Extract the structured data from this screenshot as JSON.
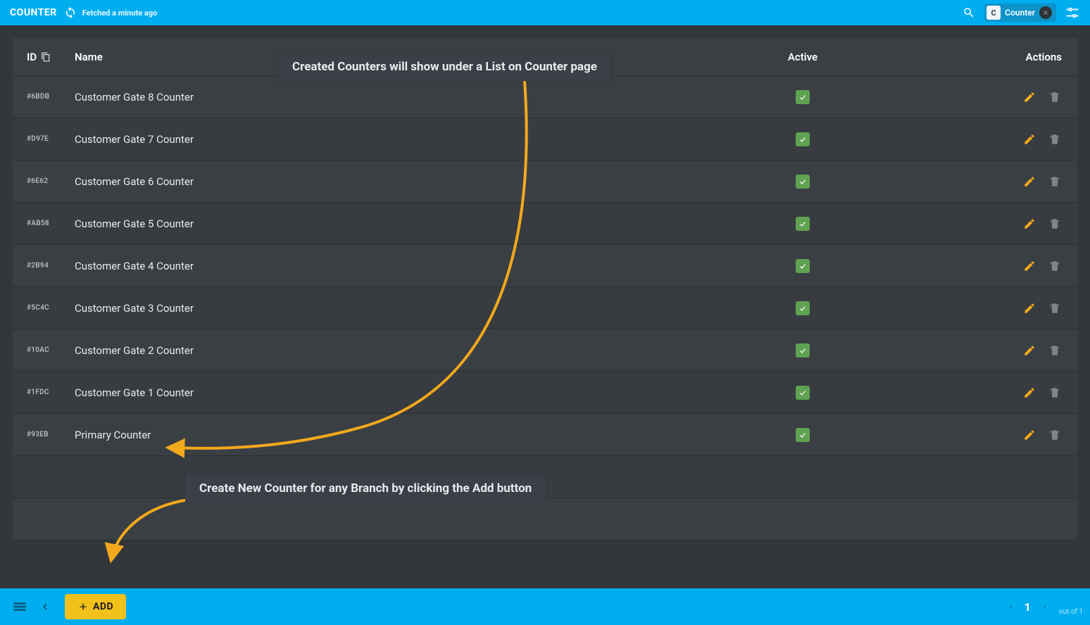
{
  "header": {
    "title": "COUNTER",
    "fetched_text": "Fetched a minute ago",
    "chip": {
      "avatar_letter": "C",
      "label": "Counter"
    }
  },
  "table": {
    "columns": {
      "id": "ID",
      "name": "Name",
      "active": "Active",
      "actions": "Actions"
    },
    "rows": [
      {
        "id": "#6BDB",
        "name": "Customer Gate 8 Counter",
        "active": true
      },
      {
        "id": "#D97E",
        "name": "Customer Gate 7 Counter",
        "active": true
      },
      {
        "id": "#6E62",
        "name": "Customer Gate 6 Counter",
        "active": true
      },
      {
        "id": "#AB58",
        "name": "Customer Gate 5 Counter",
        "active": true
      },
      {
        "id": "#2B94",
        "name": "Customer Gate 4 Counter",
        "active": true
      },
      {
        "id": "#5C4C",
        "name": "Customer Gate 3 Counter",
        "active": true
      },
      {
        "id": "#10AC",
        "name": "Customer Gate 2 Counter",
        "active": true
      },
      {
        "id": "#1FDC",
        "name": "Customer Gate 1 Counter",
        "active": true
      },
      {
        "id": "#93EB",
        "name": "Primary Counter",
        "active": true
      }
    ]
  },
  "footer": {
    "add_label": "ADD",
    "page_current": "1",
    "page_outof": "out of 1"
  },
  "annotations": {
    "top": "Created Counters will show under a List on Counter page",
    "bottom": "Create New Counter for any Branch by clicking the Add button"
  },
  "colors": {
    "accent": "#00aeef",
    "warning": "#f3a91c",
    "add_button": "#f3c11c",
    "arrow": "#f3a91c"
  }
}
